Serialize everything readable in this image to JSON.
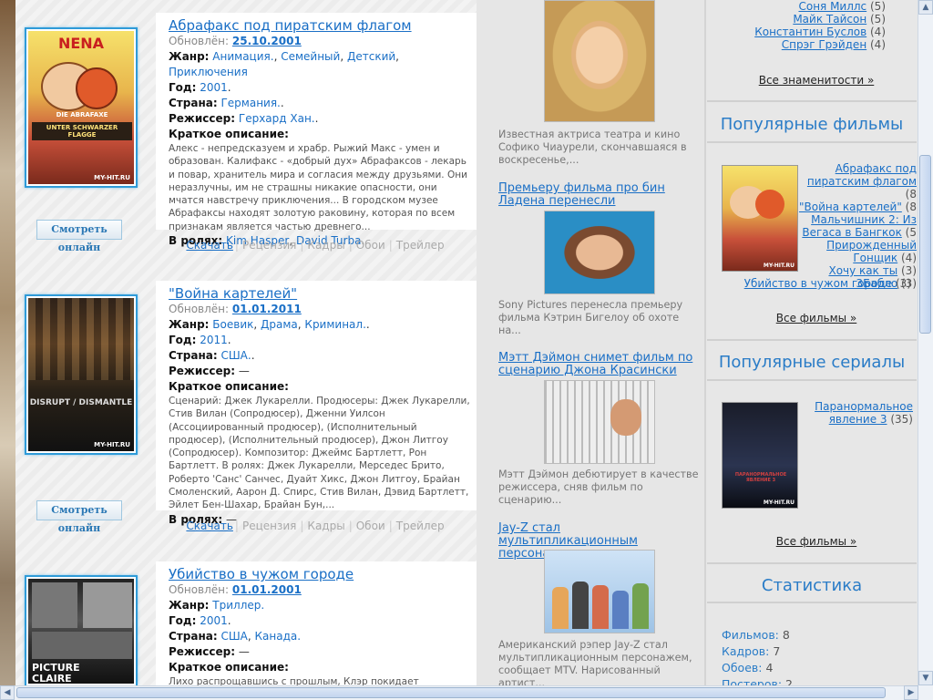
{
  "movies": [
    {
      "title": "Абрафакс под пиратским флагом",
      "updated_label": "Обновлён:",
      "updated": "25.10.2001",
      "genre_label": "Жанр:",
      "genres": [
        "Анимация.",
        "Семейный",
        "Детский",
        "Приключения"
      ],
      "year_label": "Год:",
      "year": "2001",
      "country_label": "Страна:",
      "countries": [
        "Германия."
      ],
      "director_label": "Режиссер:",
      "director": "Герхард Хан.",
      "desc_label": "Краткое описание:",
      "desc": "Алекс - непредсказуем и храбр. Рыжий Макс - умен и образован. Калифакс - «добрый дух» Абрафаксов - лекарь и повар, хранитель мира и согласия между друзьями. Они неразлучны, им не страшны никакие опасности, они мчатся навстречу приключения... В городском музее Абрафаксы находят золотую раковину, которая по всем признакам является частью древнего...",
      "cast_label": "В ролях:",
      "cast": [
        "Kim Hasper",
        "David Turba"
      ],
      "watch": "Смотреть онлайн",
      "poster_text": [
        "NENA",
        "DIE ABRAFAXE",
        "UNTER SCHWARZER FLAGGE",
        "MY-HIT.RU"
      ]
    },
    {
      "title": "\"Война картелей\"",
      "updated_label": "Обновлён:",
      "updated": "01.01.2011",
      "genre_label": "Жанр:",
      "genres": [
        "Боевик",
        "Драма",
        "Криминал."
      ],
      "year_label": "Год:",
      "year": "2011",
      "country_label": "Страна:",
      "countries": [
        "США."
      ],
      "director_label": "Режиссер:",
      "director": "—",
      "desc_label": "Краткое описание:",
      "desc": "Сценарий: Джек Лукарелли. Продюсеры: Джек Лукарелли, Стив Вилан (Сопродюсер), Дженни Уилсон (Ассоциированный продюсер), (Исполнительный продюсер), (Исполнительный продюсер), Джон Литгоу (Сопродюсер). Композитор: Джеймс Бартлетт, Рон Бартлетт. В ролях: Джек Лукарелли, Мерседес Брито, Роберто 'Санс' Санчес, Дуайт Хикс, Джон Литгоу, Брайан Смоленский, Аарон Д. Спирс, Стив Вилан, Дэвид Бартлетт, Эйлет Бен-Шахар, Брайан Бун,...",
      "cast_label": "В ролях:",
      "cast_plain": "—",
      "watch": "Смотреть онлайн",
      "poster_text": [
        "DISRUPT / DISMANTLE",
        "MY-HIT.RU"
      ]
    },
    {
      "title": "Убийство в чужом городе",
      "updated_label": "Обновлён:",
      "updated": "01.01.2001",
      "genre_label": "Жанр:",
      "genres": [
        "Триллер."
      ],
      "year_label": "Год:",
      "year": "2001",
      "country_label": "Страна:",
      "countries": [
        "США",
        "Канада."
      ],
      "director_label": "Режиссер:",
      "director": "—",
      "desc_label": "Краткое описание:",
      "desc": "Лихо распрощавшись с прошлым, Клэр покидает Монреаль,",
      "poster_text": [
        "PICTURE",
        "CLAIRE"
      ]
    }
  ],
  "actions": {
    "download": "Скачать",
    "review": "Рецензия",
    "frames": "Кадры",
    "wallpapers": "Обои",
    "trailer": "Трейлер"
  },
  "news": [
    {
      "title": "",
      "text": "Известная актриса театра и кино Софико Чиаурели, скончавшаяся в воскресенье,..."
    },
    {
      "title": "Премьеру фильма про бин Ладена перенесли",
      "text": "Sony Pictures перенесла премьеру фильма Кэтрин Бигелоу об охоте на..."
    },
    {
      "title": "Мэтт Дэймон снимет фильм по сценарию Джона Красински",
      "text": "Мэтт Дэймон дебютирует в качестве режиссера, сняв фильм по сценарию..."
    },
    {
      "title": "Jay-Z стал мультипликационным персонажем",
      "text": "Американский рэпер Jay-Z стал мультипликационным персонажем, сообщает MTV. Нарисованный артист..."
    }
  ],
  "celebs": [
    {
      "name": "Соня Миллс",
      "count": "(5)"
    },
    {
      "name": "Майк Тайсон",
      "count": "(5)"
    },
    {
      "name": "Константин Буслов",
      "count": "(4)"
    },
    {
      "name": "Спрэг Грэйден",
      "count": "(4)"
    }
  ],
  "all_celebs": "Все знаменитости »",
  "popular_films": {
    "heading": "Популярные фильмы",
    "items": [
      {
        "name": "Абрафакс под пиратским флагом",
        "count": "(8"
      },
      {
        "name": "\"Война картелей\"",
        "count": "(8"
      },
      {
        "name": "Мальчишник 2: Из Вегаса в Бангкок",
        "count": "(5"
      },
      {
        "name": "Прирожденный Гонщик",
        "count": "(4)"
      },
      {
        "name": "Хочу как ты",
        "count": "(3)"
      },
      {
        "name": "3Бабло",
        "count": "(3)"
      },
      {
        "name": "Убийство в чужом городе",
        "count": "(3)"
      }
    ],
    "all": "Все фильмы »"
  },
  "popular_series": {
    "heading": "Популярные сериалы",
    "items": [
      {
        "name": "Паранормальное явление 3",
        "count": "(35)"
      }
    ],
    "all": "Все фильмы »",
    "poster_text": [
      "ПАРАНОРМАЛЬНОЕ ЯВЛЕНИЕ 3",
      "MY-HIT.RU"
    ]
  },
  "stats": {
    "heading": "Статистика",
    "items": [
      {
        "label": "Фильмов:",
        "value": "8"
      },
      {
        "label": "Кадров:",
        "value": "7"
      },
      {
        "label": "Обоев:",
        "value": "4"
      },
      {
        "label": "Постеров:",
        "value": "2"
      }
    ]
  },
  "colors": {
    "link": "#1a6fc6",
    "poster_border": "#2f9bd8",
    "heading": "#2a7cc7"
  }
}
